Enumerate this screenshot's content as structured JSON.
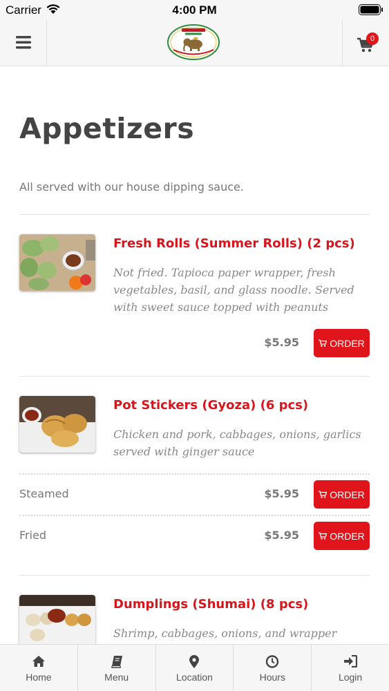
{
  "status_bar": {
    "carrier": "Carrier",
    "time": "4:00 PM"
  },
  "header": {
    "logo_icon": "restaurant-logo-elephant",
    "cart_count": "0",
    "menu_icon": "hamburger-icon",
    "cart_icon": "cart-icon"
  },
  "section": {
    "title": "Appetizers",
    "description": "All served with our house dipping sauce."
  },
  "items": [
    {
      "name": "Fresh Rolls (Summer Rolls) (2 pcs)",
      "description": "Not fried. Tapioca paper wrapper, fresh vegetables, basil, and glass noodle. Served with sweet sauce topped with peanuts",
      "price": "$5.95",
      "order_label": "ORDER"
    },
    {
      "name": "Pot Stickers (Gyoza) (6 pcs)",
      "description": "Chicken and pork, cabbages, onions, garlics served with ginger sauce",
      "variants": [
        {
          "label": "Steamed",
          "price": "$5.95",
          "order_label": "ORDER"
        },
        {
          "label": "Fried",
          "price": "$5.95",
          "order_label": "ORDER"
        }
      ]
    },
    {
      "name": "Dumplings (Shumai) (8 pcs)",
      "description": "Shrimp, cabbages, onions, and wrapper served"
    }
  ],
  "tabs": [
    {
      "label": "Home",
      "icon": "home-icon"
    },
    {
      "label": "Menu",
      "icon": "book-icon"
    },
    {
      "label": "Location",
      "icon": "map-pin-icon"
    },
    {
      "label": "Hours",
      "icon": "clock-icon"
    },
    {
      "label": "Login",
      "icon": "login-icon"
    }
  ],
  "colors": {
    "accent": "#e0151b",
    "item_name": "#d5161c",
    "bar_bg": "#f6f6f6"
  }
}
